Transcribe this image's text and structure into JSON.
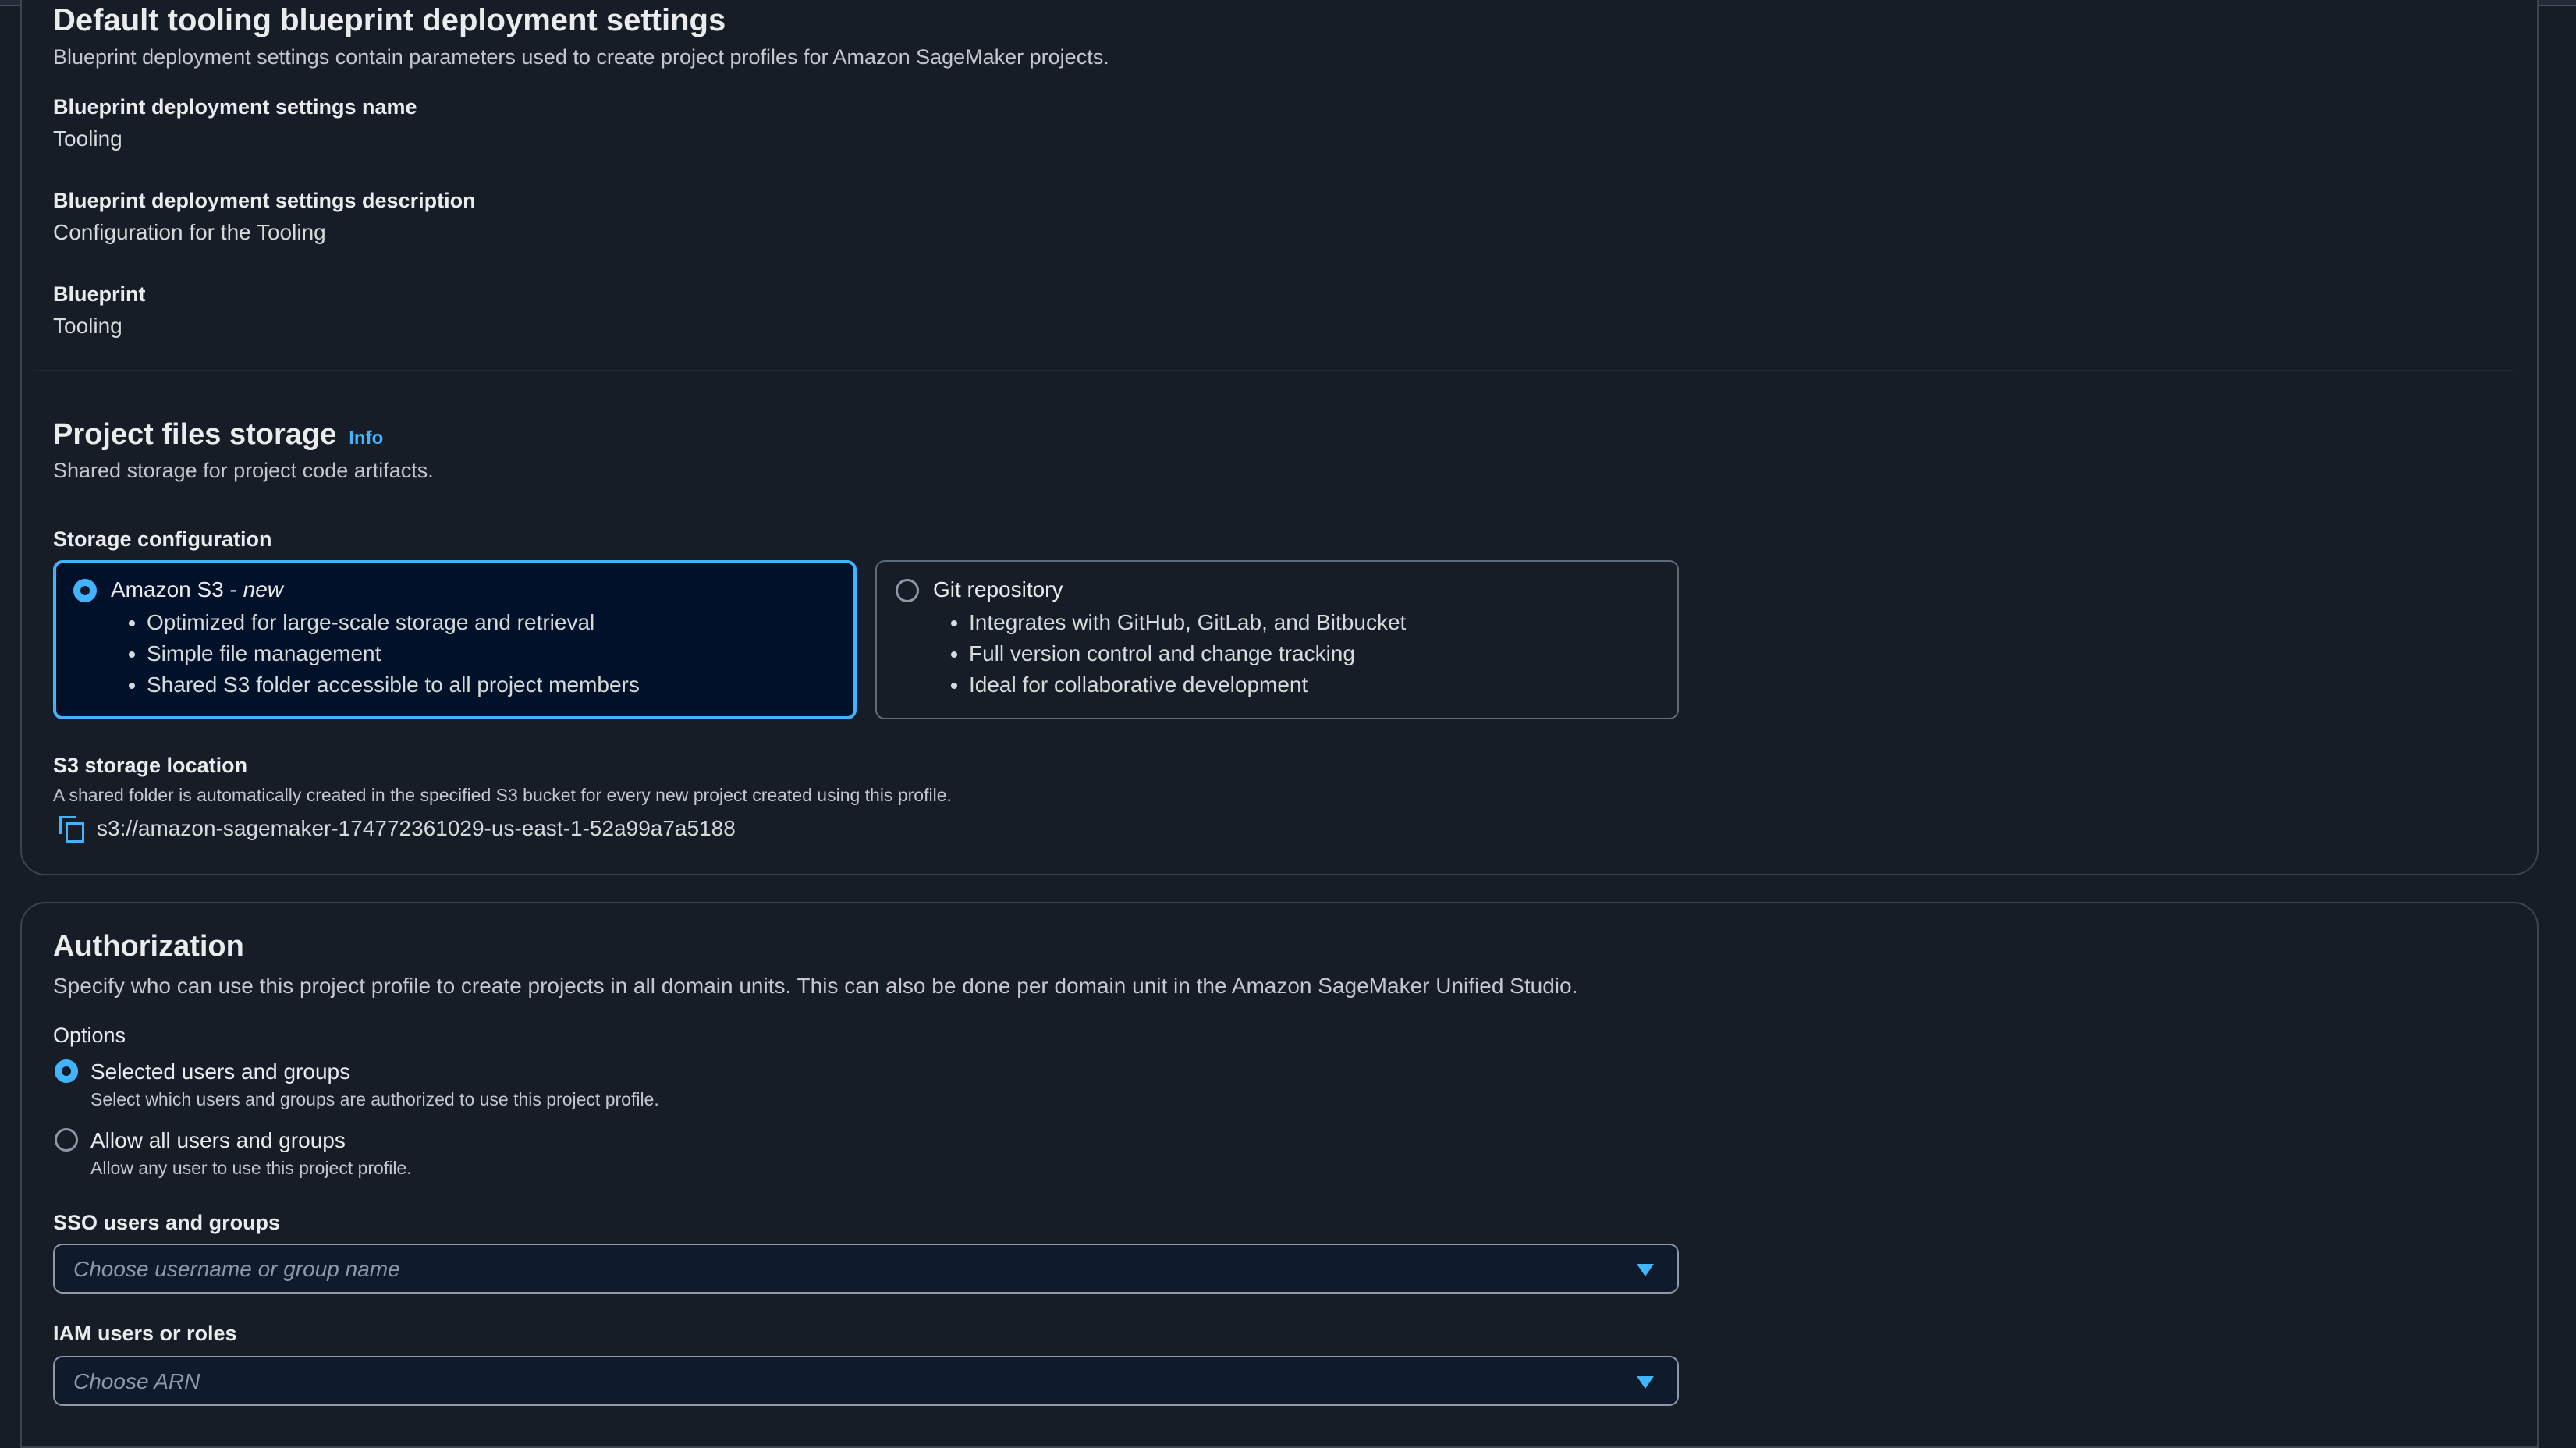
{
  "blueprint": {
    "title": "Default tooling blueprint deployment settings",
    "description": "Blueprint deployment settings contain parameters used to create project profiles for Amazon SageMaker projects.",
    "fields": [
      {
        "label": "Blueprint deployment settings name",
        "value": "Tooling"
      },
      {
        "label": "Blueprint deployment settings description",
        "value": "Configuration for the Tooling"
      },
      {
        "label": "Blueprint",
        "value": "Tooling"
      }
    ]
  },
  "storage": {
    "title": "Project files storage",
    "info_link": "Info",
    "description": "Shared storage for project code artifacts.",
    "config_label": "Storage configuration",
    "options": [
      {
        "title": "Amazon S3 - ",
        "title_suffix": "new",
        "selected": true,
        "bullets": [
          "Optimized for large-scale storage and retrieval",
          "Simple file management",
          "Shared S3 folder accessible to all project members"
        ]
      },
      {
        "title": "Git repository",
        "title_suffix": "",
        "selected": false,
        "bullets": [
          "Integrates with GitHub, GitLab, and Bitbucket",
          "Full version control and change tracking",
          "Ideal for collaborative development"
        ]
      }
    ],
    "location_label": "S3 storage location",
    "location_description": "A shared folder is automatically created in the specified S3 bucket for every new project created using this profile.",
    "location_value": "s3://amazon-sagemaker-174772361029-us-east-1-52a99a7a5188"
  },
  "authorization": {
    "title": "Authorization",
    "description": "Specify who can use this project profile to create projects in all domain units. This can also be done per domain unit in the Amazon SageMaker Unified Studio.",
    "options_label": "Options",
    "options": [
      {
        "title": "Selected users and groups",
        "description": "Select which users and groups are authorized to use this project profile.",
        "selected": true
      },
      {
        "title": "Allow all users and groups",
        "description": "Allow any user to use this project profile.",
        "selected": false
      }
    ],
    "sso_label": "SSO users and groups",
    "sso_placeholder": "Choose username or group name",
    "iam_label": "IAM users or roles",
    "iam_placeholder": "Choose ARN"
  },
  "colors": {
    "accent": "#42b4ff",
    "background": "#161d26",
    "selected_tile": "#001129"
  }
}
